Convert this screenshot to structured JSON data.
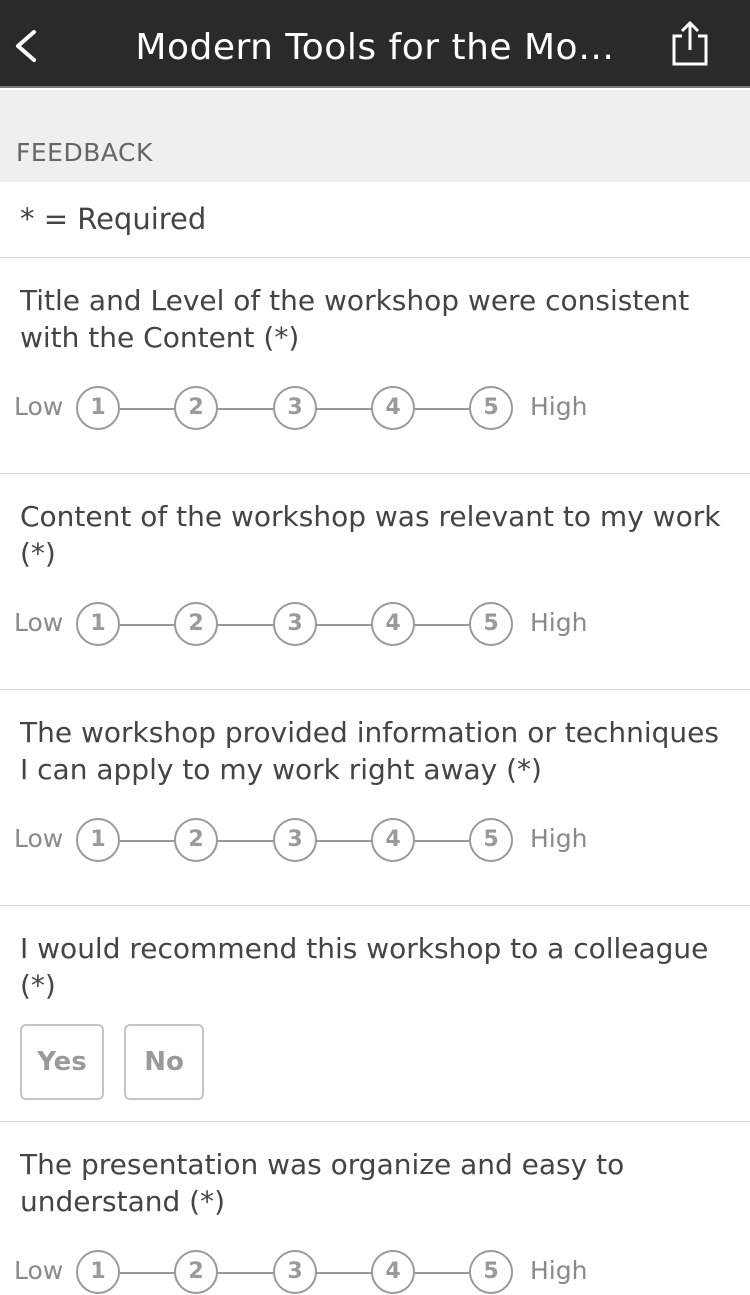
{
  "nav": {
    "title": "Modern Tools for the Mo…"
  },
  "section": {
    "header": "FEEDBACK",
    "required_note": "* = Required"
  },
  "rating_scale": {
    "low_label": "Low",
    "high_label": "High",
    "options": [
      "1",
      "2",
      "3",
      "4",
      "5"
    ]
  },
  "questions": [
    {
      "text": "Title and Level of the workshop were consistent with the Content  (*)",
      "type": "rating"
    },
    {
      "text": "Content of the workshop was relevant to my work (*)",
      "type": "rating"
    },
    {
      "text": "The workshop provided information or techniques I can apply to my work right away (*)",
      "type": "rating"
    },
    {
      "text": "I would recommend this workshop to a colleague (*)",
      "type": "yes_no",
      "yes_label": "Yes",
      "no_label": "No"
    },
    {
      "text": "The presentation was organize and easy to understand (*)",
      "type": "rating"
    }
  ]
}
